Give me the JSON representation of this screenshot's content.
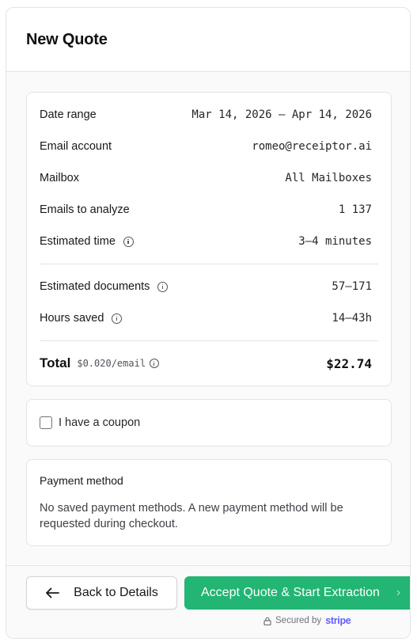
{
  "dialog": {
    "title": "New Quote"
  },
  "summary": {
    "rows": [
      {
        "label": "Date range",
        "value": "Mar 14, 2026 – Apr 14, 2026"
      },
      {
        "label": "Email account",
        "value": "romeo@receiptor.ai"
      },
      {
        "label": "Mailbox",
        "value": "All Mailboxes"
      },
      {
        "label": "Emails to analyze",
        "value": "1 137"
      },
      {
        "label": "Estimated time",
        "value": "3–4 minutes",
        "icon": "info-icon"
      }
    ],
    "estimates": [
      {
        "label": "Estimated documents",
        "value": "57–171",
        "icon": "info-icon"
      },
      {
        "label": "Hours saved",
        "value": "14–43h",
        "icon": "info-icon"
      }
    ],
    "total": {
      "label": "Total",
      "rate": "$0.020/email",
      "value": "$22.74"
    }
  },
  "coupon": {
    "label": "I have a coupon",
    "checked": false
  },
  "payment": {
    "title": "Payment method",
    "text": "No saved payment methods. A new payment method will be requested during checkout."
  },
  "footer": {
    "back_label": "Back to Details",
    "accept_label": "Accept Quote & Start Extraction",
    "secured_text": "Secured by",
    "secured_brand": "stripe",
    "accept_color": "#22b573"
  }
}
